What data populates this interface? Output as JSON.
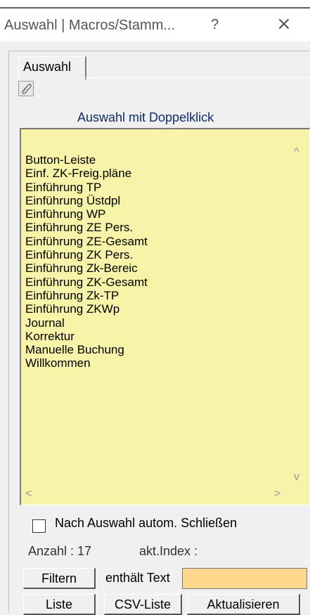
{
  "window": {
    "title": "Auswahl | Macros/Stamm...",
    "help_label": "?",
    "close_label": "×"
  },
  "tab": {
    "label": "Auswahl"
  },
  "list": {
    "caption": "Auswahl mit Doppelklick",
    "items": [
      "Button-Leiste",
      "Einf. ZK-Freig.pläne",
      "Einführung TP",
      "Einführung Üstdpl",
      "Einführung WP",
      "Einführung ZE Pers.",
      "Einführung ZE-Gesamt",
      "Einführung ZK Pers.",
      "Einführung Zk-Bereic",
      "Einführung ZK-Gesamt",
      "Einführung Zk-TP",
      "Einführung ZKWp",
      "Journal",
      "Korrektur",
      "Manuelle Buchung",
      "Willkommen"
    ],
    "background": "#f7f3a8"
  },
  "scroll": {
    "up": "^",
    "down": "v",
    "left": "<",
    "right": ">"
  },
  "options": {
    "close_after_selection_label": "Nach Auswahl autom. Schließen",
    "checked": false
  },
  "status": {
    "count_label": "Anzahl : 17",
    "index_label": "akt.Index :"
  },
  "filter": {
    "button_label": "Filtern",
    "text_label": "enthält Text",
    "value": "",
    "input_color": "#ffd88e"
  },
  "buttons": {
    "list": "Liste",
    "csv_list": "CSV-Liste",
    "refresh": "Aktualisieren"
  }
}
